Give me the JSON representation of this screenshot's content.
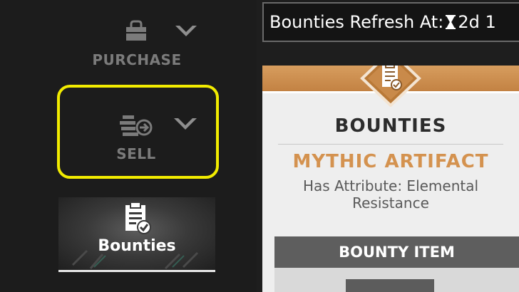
{
  "nav": {
    "purchase": {
      "label": "PURCHASE",
      "icon": "shopping-bag-icon",
      "chevron": "chevron-down-icon"
    },
    "sell": {
      "label": "SELL",
      "icon": "sell-stack-icon",
      "chevron": "chevron-down-icon",
      "highlighted": true
    },
    "tile": {
      "label": "Bounties",
      "icon": "clipboard-check-icon"
    }
  },
  "refresh": {
    "label": "Bounties Refresh At:",
    "timer_icon": "hourglass-icon",
    "value": "2d 1"
  },
  "card": {
    "emblem_icon": "clipboard-check-icon",
    "title": "BOUNTIES",
    "subtitle": "MYTHIC ARTIFACT",
    "description": "Has Attribute: Elemental Resistance",
    "item_header": "BOUNTY ITEM"
  },
  "colors": {
    "highlight": "#f2ec00",
    "accent_orange": "#d4924f",
    "header_orange": "#c98a4a",
    "background": "#1c1c1c"
  }
}
